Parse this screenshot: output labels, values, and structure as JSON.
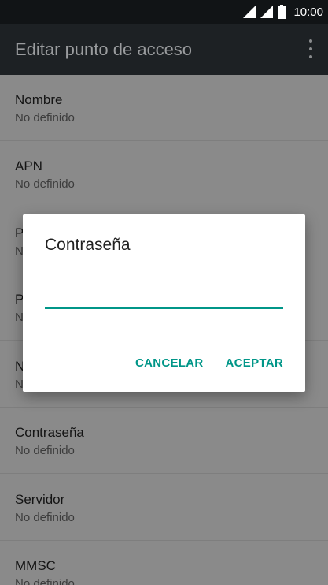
{
  "status_bar": {
    "time": "10:00",
    "icons": [
      "wifi-signal-icon",
      "cell-signal-icon",
      "battery-icon"
    ]
  },
  "app_bar": {
    "title": "Editar punto de acceso",
    "menu_icon": "overflow-menu-icon"
  },
  "settings": [
    {
      "title": "Nombre",
      "value": "No definido"
    },
    {
      "title": "APN",
      "value": "No definido"
    },
    {
      "title": "P",
      "value": "N"
    },
    {
      "title": "P",
      "value": "N"
    },
    {
      "title": "N",
      "value": "N"
    },
    {
      "title": "Contraseña",
      "value": "No definido"
    },
    {
      "title": "Servidor",
      "value": "No definido"
    },
    {
      "title": "MMSC",
      "value": "No definido"
    }
  ],
  "dialog": {
    "title": "Contraseña",
    "input_value": "",
    "cancel_label": "CANCELAR",
    "accept_label": "ACEPTAR"
  },
  "colors": {
    "accent": "#009688",
    "app_bar": "#1d2124",
    "status_bar": "#111416",
    "scrim_background": "#8a8a8a"
  }
}
